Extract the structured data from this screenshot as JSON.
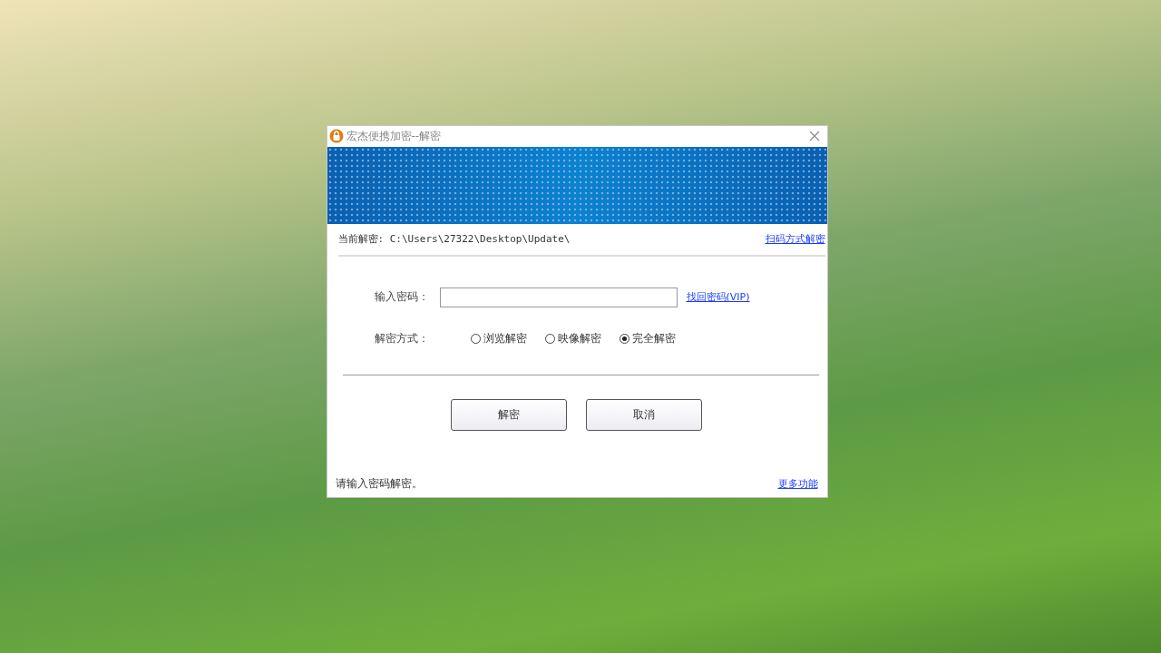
{
  "window": {
    "title": "宏杰便携加密--解密"
  },
  "path_row": {
    "label": "当前解密: C:\\Users\\27322\\Desktop\\Update\\",
    "link": "扫码方式解密"
  },
  "password": {
    "label": "输入密码：",
    "link": "找回密码(VIP)"
  },
  "mode": {
    "label": "解密方式：",
    "options": [
      {
        "label": "浏览解密",
        "selected": false
      },
      {
        "label": "映像解密",
        "selected": false
      },
      {
        "label": "完全解密",
        "selected": true
      }
    ]
  },
  "buttons": [
    "解密",
    "取消"
  ],
  "status": {
    "text": "请输入密码解密。",
    "link": "更多功能"
  }
}
